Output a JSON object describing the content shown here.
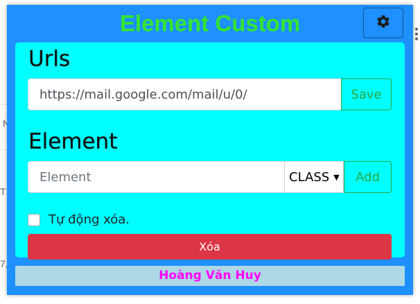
{
  "popup": {
    "title": "Element Custom",
    "settings_icon": "gear-icon"
  },
  "urls_section": {
    "heading": "Urls",
    "url_value": "https://mail.google.com/mail/u/0/",
    "save_label": "Save"
  },
  "element_section": {
    "heading": "Element",
    "input_placeholder": "Element",
    "selector_type": "CLASS",
    "add_label": "Add"
  },
  "auto_delete": {
    "label": "Tự động xóa.",
    "checked": false
  },
  "delete_label": "Xóa",
  "footer": {
    "author": "Hoàng Văn Huy"
  },
  "background_page": {
    "hint_1": "N",
    "hint_2": "T",
    "hint_3": "7,"
  },
  "colors": {
    "popup_bg": "#1e90ff",
    "card_bg": "#00ffff",
    "title": "#33e533",
    "success": "#28a745",
    "danger": "#dc3545",
    "footer_bg": "#add8e6",
    "footer_text": "#ff00ff"
  }
}
